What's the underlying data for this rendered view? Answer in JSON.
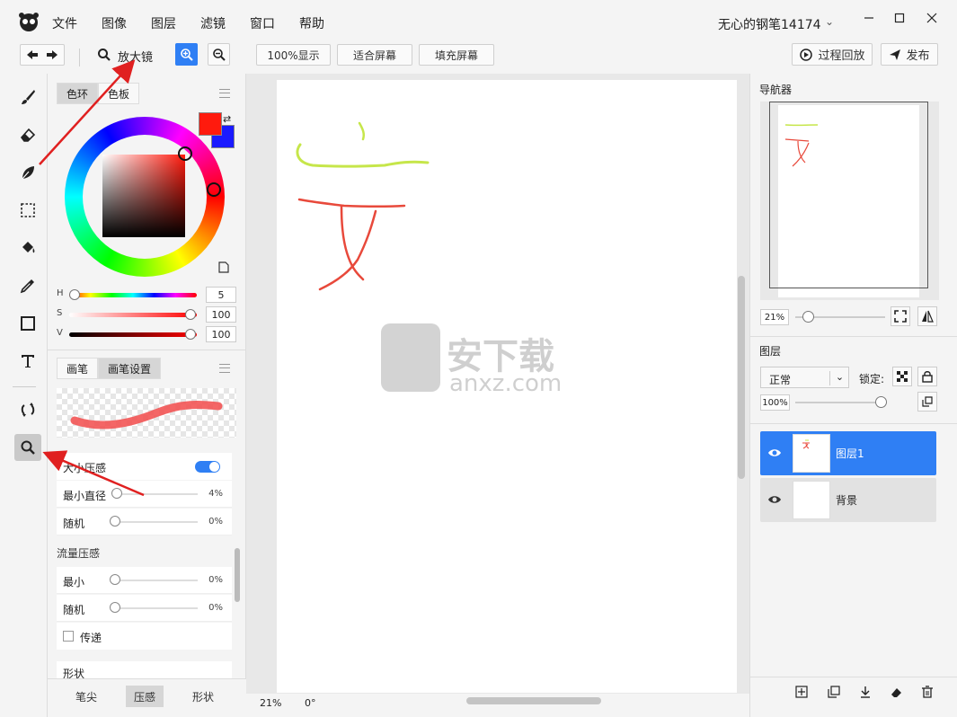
{
  "menu": [
    "文件",
    "图像",
    "图层",
    "滤镜",
    "窗口",
    "帮助"
  ],
  "user": {
    "name": "无心的钢笔14174"
  },
  "toolbar": {
    "tool_name": "放大镜",
    "btn_100": "100%显示",
    "btn_fit": "适合屏幕",
    "btn_fill": "填充屏幕",
    "btn_replay": "过程回放",
    "btn_publish": "发布"
  },
  "left_tools": [
    "brush-icon",
    "eraser-icon",
    "leaf-icon",
    "marquee-icon",
    "bucket-icon",
    "eyedropper-icon",
    "rectangle-icon",
    "text-icon",
    "rotate-icon",
    "magnifier-icon"
  ],
  "color_panel": {
    "tabs": [
      "色环",
      "色板"
    ],
    "h_label": "H",
    "h_value": "5",
    "s_label": "S",
    "s_value": "100",
    "v_label": "V",
    "v_value": "100",
    "fg_color": "#ff1a0d",
    "bg_color": "#1a1aff"
  },
  "brush_panel": {
    "tabs": [
      "画笔",
      "画笔设置"
    ],
    "size_pressure": "大小压感",
    "min_diameter": "最小直径",
    "min_diameter_value": "4%",
    "random1": "随机",
    "random1_value": "0%",
    "flow_pressure": "流量压感",
    "min": "最小",
    "min_value": "0%",
    "random2": "随机",
    "random2_value": "0%",
    "transfer": "传递",
    "shape_cut": "形状"
  },
  "bottom_tabs": [
    "笔尖",
    "压感",
    "形状"
  ],
  "status": {
    "zoom": "21%",
    "angle": "0°"
  },
  "navigator": {
    "title": "导航器",
    "zoom": "21%"
  },
  "layers": {
    "title": "图层",
    "blend": "正常",
    "lock_label": "锁定:",
    "opacity": "100%",
    "items": [
      {
        "name": "图层1"
      },
      {
        "name": "背景"
      }
    ]
  },
  "watermark": {
    "text": "安下载",
    "sub": "anxz.com"
  },
  "colors": {
    "accent": "#2f7ff4",
    "annot": "#e02020"
  }
}
